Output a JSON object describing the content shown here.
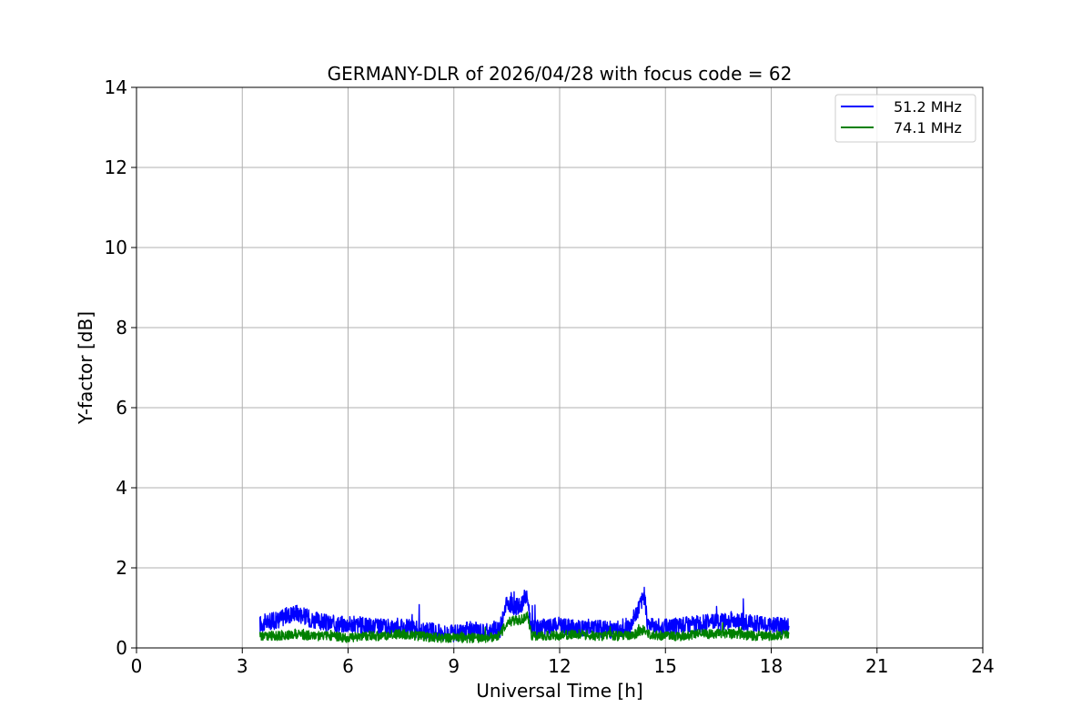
{
  "chart_data": {
    "type": "line",
    "title": "GERMANY-DLR of 2026/04/28 with focus code = 62",
    "xlabel": "Universal Time [h]",
    "ylabel": "Y-factor [dB]",
    "xlim": [
      0,
      24
    ],
    "ylim": [
      0,
      14
    ],
    "xticks": [
      0,
      3,
      6,
      9,
      12,
      15,
      18,
      21,
      24
    ],
    "xtick_labels": [
      "0",
      "3",
      "6",
      "9",
      "12",
      "15",
      "18",
      "21",
      "24"
    ],
    "yticks": [
      0,
      2,
      4,
      6,
      8,
      10,
      12,
      14
    ],
    "ytick_labels": [
      "0",
      "2",
      "4",
      "6",
      "8",
      "10",
      "12",
      "14"
    ],
    "grid": true,
    "legend_position": "top-right",
    "series": [
      {
        "name": "51.2 MHz",
        "color": "#0000ff",
        "x": [
          3.5,
          4.0,
          4.5,
          5.0,
          5.5,
          6.0,
          6.5,
          7.0,
          7.5,
          8.0,
          8.5,
          9.0,
          9.5,
          10.0,
          10.3,
          10.5,
          10.9,
          11.0,
          11.1,
          11.2,
          11.5,
          12.0,
          12.5,
          13.0,
          13.5,
          14.0,
          14.4,
          14.5,
          15.0,
          15.5,
          16.0,
          16.5,
          17.0,
          17.5,
          18.0,
          18.5
        ],
        "y": [
          0.6,
          0.7,
          0.9,
          0.7,
          0.6,
          0.6,
          0.55,
          0.5,
          0.55,
          0.45,
          0.4,
          0.35,
          0.45,
          0.4,
          0.45,
          1.1,
          1.0,
          1.3,
          1.2,
          0.45,
          0.5,
          0.55,
          0.5,
          0.5,
          0.45,
          0.55,
          1.3,
          0.6,
          0.5,
          0.55,
          0.6,
          0.65,
          0.7,
          0.6,
          0.55,
          0.55
        ]
      },
      {
        "name": "74.1 MHz",
        "color": "#008000",
        "x": [
          3.5,
          4.0,
          4.5,
          5.0,
          5.5,
          6.0,
          6.5,
          7.0,
          7.5,
          8.0,
          8.5,
          9.0,
          9.5,
          10.0,
          10.3,
          10.5,
          10.9,
          11.0,
          11.1,
          11.2,
          11.5,
          12.0,
          12.5,
          13.0,
          13.5,
          14.0,
          14.4,
          14.5,
          15.0,
          15.5,
          16.0,
          16.5,
          17.0,
          17.5,
          18.0,
          18.5
        ],
        "y": [
          0.3,
          0.3,
          0.35,
          0.3,
          0.3,
          0.25,
          0.3,
          0.3,
          0.35,
          0.3,
          0.25,
          0.25,
          0.25,
          0.25,
          0.3,
          0.65,
          0.7,
          0.75,
          0.8,
          0.3,
          0.3,
          0.3,
          0.35,
          0.3,
          0.3,
          0.3,
          0.45,
          0.35,
          0.3,
          0.3,
          0.35,
          0.35,
          0.35,
          0.3,
          0.3,
          0.35
        ]
      }
    ]
  }
}
